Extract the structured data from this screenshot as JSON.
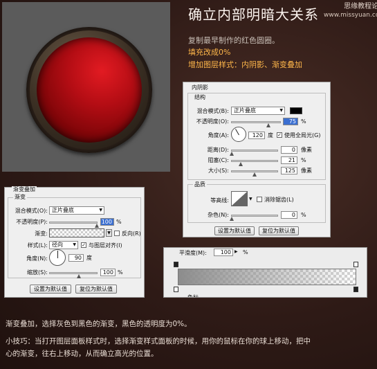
{
  "heading": {
    "title": "确立内部明暗大关系",
    "watermark_line1": "思缘教程论坛",
    "watermark_line2": "www.missyuan.com"
  },
  "intro": {
    "line1": "复制最早制作的红色圆圈。",
    "line2": "填充改成0%",
    "line3": "增加图层样式：内阴影、渐变叠加"
  },
  "inner_shadow": {
    "panel_title": "内阴影",
    "section_structure": "结构",
    "blend_mode_label": "混合模式(B):",
    "blend_mode_value": "正片叠底",
    "opacity_label": "不透明度(O):",
    "opacity_value": "75",
    "angle_label": "角度(A):",
    "angle_value": "120",
    "degree_unit": "度",
    "global_light_label": "使用全局光(G)",
    "distance_label": "距离(D):",
    "distance_value": "0",
    "choke_label": "阻塞(C):",
    "choke_value": "21",
    "size_label": "大小(S):",
    "size_value": "125",
    "px_unit": "像素",
    "pct_unit": "%",
    "section_quality": "品质",
    "contour_label": "等高线:",
    "antialias_label": "消除锯齿(L)",
    "noise_label": "杂色(N):",
    "noise_value": "0",
    "reset_default_btn": "设置为默认值",
    "restore_default_btn": "复位为默认值",
    "shadow_color": "#000000"
  },
  "gradient_overlay": {
    "panel_title": "渐变叠加",
    "section_gradient": "渐变",
    "blend_mode_label": "混合模式(O):",
    "blend_mode_value": "正片叠底",
    "opacity_label": "不透明度(P):",
    "opacity_value": "100",
    "gradient_label": "渐变:",
    "reverse_label": "反向(R)",
    "style_label": "样式(L):",
    "style_value": "径向",
    "align_label": "与图层对齐(I)",
    "angle_label": "角度(N):",
    "angle_value": "90",
    "degree_unit": "度",
    "scale_label": "缩放(S):",
    "scale_value": "100",
    "pct_unit": "%",
    "reset_default_btn": "设置为默认值",
    "restore_default_btn": "复位为默认值"
  },
  "gradient_editor": {
    "smoothness_label": "平滑度(M):",
    "smoothness_value": "100",
    "pct_unit": "%",
    "color_label": "色标"
  },
  "footer": {
    "line1": "渐变叠加，选择灰色到黑色的渐变，黑色的透明度为0%。",
    "line2": "小技巧：当打开图层面板样式时，选择渐变样式面板的时候，用你的鼠标在你的球上移动，把中",
    "line3": "心的渐变，往右上移动，从而确立高光的位置。"
  }
}
